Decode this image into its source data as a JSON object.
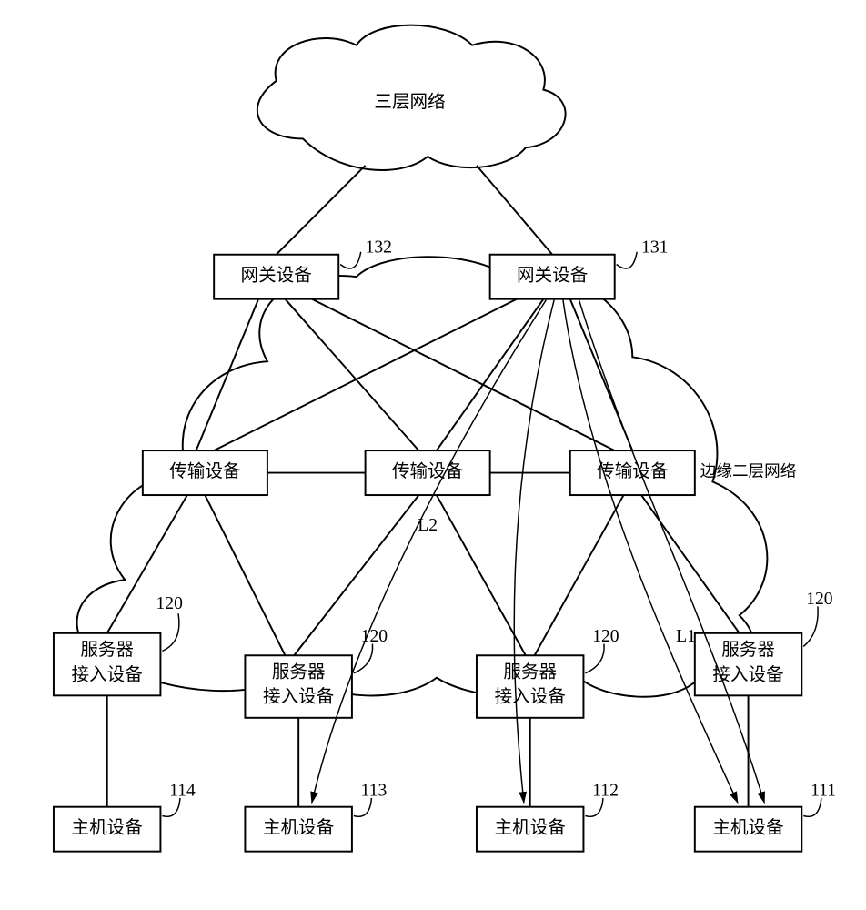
{
  "l3_cloud_label": "三层网络",
  "edge_cloud_label": "边缘二层网络",
  "gateway_left": {
    "label": "网关设备",
    "ref": "132"
  },
  "gateway_right": {
    "label": "网关设备",
    "ref": "131"
  },
  "transport_left": {
    "label": "传输设备"
  },
  "transport_mid": {
    "label": "传输设备"
  },
  "transport_right": {
    "label": "传输设备"
  },
  "access_a": {
    "line1": "服务器",
    "line2": "接入设备",
    "ref": "120"
  },
  "access_b": {
    "line1": "服务器",
    "line2": "接入设备",
    "ref": "120"
  },
  "access_c": {
    "line1": "服务器",
    "line2": "接入设备",
    "ref": "120"
  },
  "access_d": {
    "line1": "服务器",
    "line2": "接入设备",
    "ref": "120"
  },
  "host_a": {
    "label": "主机设备",
    "ref": "114"
  },
  "host_b": {
    "label": "主机设备",
    "ref": "113"
  },
  "host_c": {
    "label": "主机设备",
    "ref": "112"
  },
  "host_d": {
    "label": "主机设备",
    "ref": "111"
  },
  "flow_L1": "L1",
  "flow_L2": "L2"
}
